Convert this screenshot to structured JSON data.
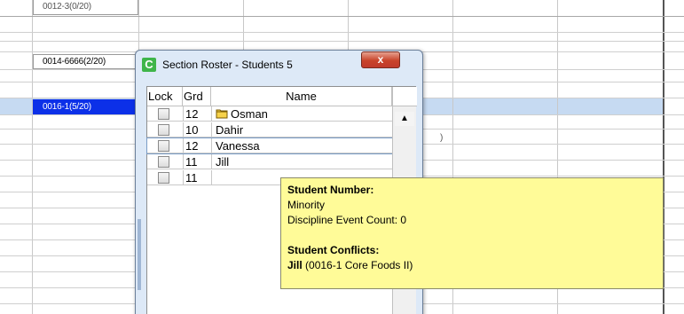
{
  "background_grid": {
    "sections": {
      "top": "0012-3(0/20)",
      "middle": "0014-6666(2/20)",
      "selected": "0016-1(5/20)"
    },
    "partial_cell_text": ")"
  },
  "dialog": {
    "title": "Section Roster - Students 5",
    "close_label": "x",
    "app_icon_letter": "C",
    "columns": {
      "lock": "Lock",
      "grade": "Grd",
      "name": "Name"
    },
    "rows": [
      {
        "grade": "12",
        "name": "Osman",
        "has_folder_icon": true
      },
      {
        "grade": "10",
        "name": "Dahir",
        "has_folder_icon": false
      },
      {
        "grade": "12",
        "name": "Vanessa",
        "has_folder_icon": false
      },
      {
        "grade": "11",
        "name": "Jill",
        "has_folder_icon": false
      },
      {
        "grade": "11",
        "name": "",
        "has_folder_icon": false
      }
    ],
    "scroll_up_glyph": "▲"
  },
  "tooltip": {
    "student_number_label": "Student Number:",
    "minority_label": "Minority",
    "discipline_label": "Discipline Event Count: 0",
    "conflicts_label": "Student Conflicts:",
    "conflict_student": "Jill",
    "conflict_detail": "(0016-1 Core Foods II)"
  },
  "colors": {
    "selected_cell": "#0c30e8",
    "highlight_row": "#c6daf2",
    "tooltip_bg": "#fffb98",
    "dialog_bg": "#dde9f7",
    "close_button": "#c8432a",
    "app_icon": "#3fb54a"
  }
}
